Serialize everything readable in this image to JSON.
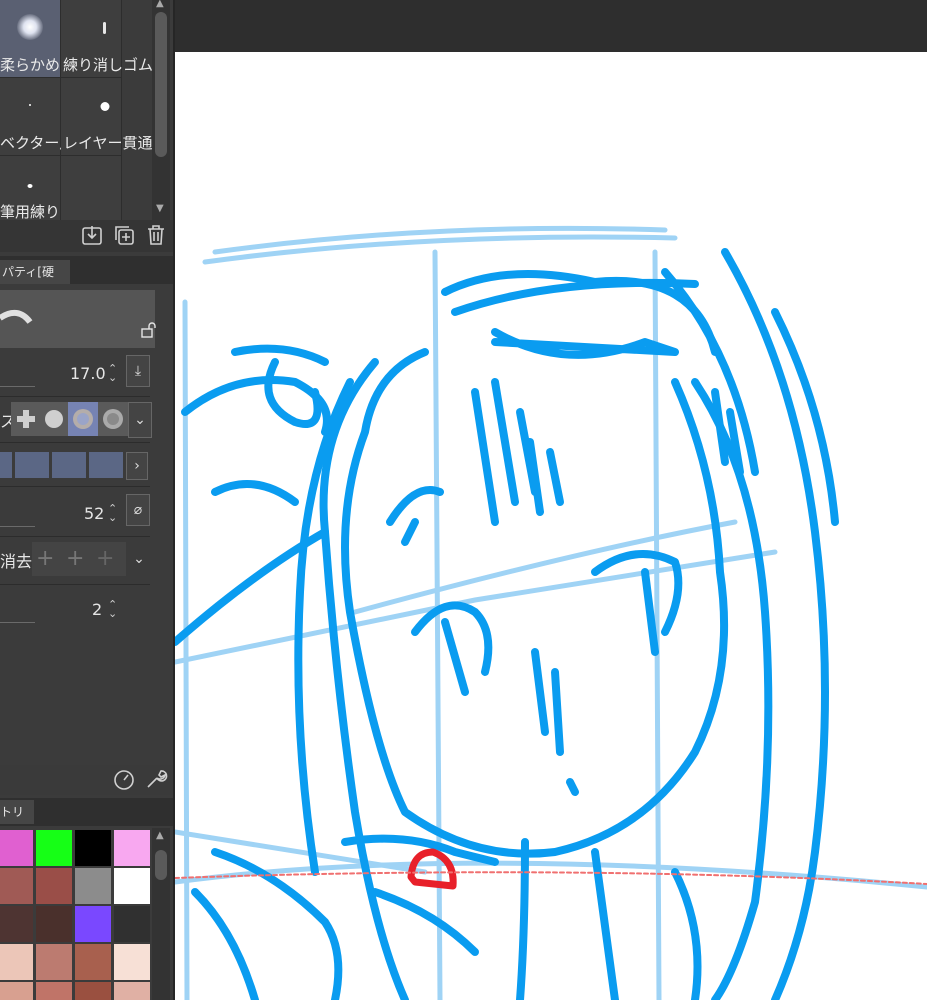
{
  "brushes": [
    {
      "label": "柔らかめ",
      "selected": true
    },
    {
      "label": "練り消しゴム",
      "selected": false
    },
    {
      "label": "ベクター用",
      "selected": false
    },
    {
      "label": "レイヤー貫通",
      "selected": false
    },
    {
      "label": "筆用練り",
      "selected": false
    }
  ],
  "property_tab": "パティ[硬め]",
  "props": {
    "size_value": "17.0",
    "hardness_value": "52",
    "erase_label": "消去",
    "tip_prefix": "ス",
    "count_value": "2"
  },
  "palette_tab": "トリー",
  "swatches": [
    [
      "#e060d0",
      "#16ff16",
      "#000000",
      "#f8a8f0"
    ],
    [
      "#a05a55",
      "#9a4e48",
      "#8c8c8c",
      "#ffffff"
    ],
    [
      "#4e3432",
      "#4a302c",
      "#7a48ff",
      "#303030"
    ],
    [
      "#ecc6b8",
      "#bc7b70",
      "#a8604e",
      "#f7e0d6"
    ],
    [
      "#d8a090",
      "#c07468",
      "#9a5040",
      "#e0b0a4"
    ]
  ],
  "colors": {
    "sketch_blue": "#0a9cf0",
    "guide_blue": "#9fd3f5",
    "red_mark": "#e8202a"
  }
}
